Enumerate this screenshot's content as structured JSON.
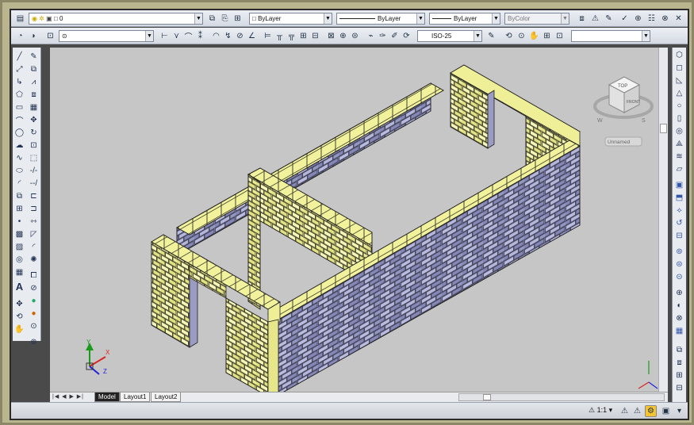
{
  "toolbar": {
    "layer_value": "0",
    "color_value": "ByLayer",
    "linetype_value": "ByLayer",
    "lineweight_value": "ByLayer",
    "plotstyle_value": "ByColor",
    "dimstyle_value": "ISO-25"
  },
  "viewcube": {
    "face_top": "TOP",
    "face_front": "FRONT",
    "compass_w": "W",
    "compass_s": "S",
    "ucs_label": "Unnamed"
  },
  "ucs_axes": {
    "x": "X",
    "y": "Y",
    "z": "Z"
  },
  "tabs": [
    "Model",
    "Layout1",
    "Layout2"
  ],
  "status": {
    "scale": "1:1"
  },
  "colors": {
    "brick_side": "#9a9cc4",
    "brick_top": "#efef98",
    "background": "#c6c6c6",
    "frame": "#b9b58e"
  },
  "icons": {
    "left_toolbar": [
      "line-icon",
      "xline-icon",
      "polyline-icon",
      "polygon-icon",
      "rectangle-icon",
      "arc-icon",
      "circle-icon",
      "revcloud-icon",
      "spline-icon",
      "ellipse-icon",
      "ellipse-arc-icon",
      "insert-block-icon",
      "make-block-icon",
      "point-icon",
      "hatch-icon",
      "gradient-icon",
      "region-icon",
      "table-icon",
      "text-icon"
    ],
    "modify_toolbar": [
      "erase-icon",
      "copy-icon",
      "mirror-icon",
      "offset-icon",
      "array-icon",
      "move-icon",
      "rotate-icon",
      "scale-icon",
      "stretch-icon",
      "trim-icon",
      "extend-icon",
      "break-icon",
      "join-icon",
      "chamfer-icon",
      "fillet-icon",
      "explode-icon"
    ]
  }
}
